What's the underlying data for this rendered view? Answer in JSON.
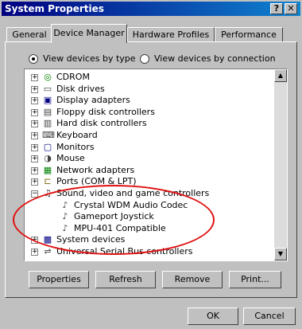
{
  "window": {
    "title": "System Properties",
    "help_label": "?",
    "close_label": "✕"
  },
  "tabs": [
    {
      "label": "General"
    },
    {
      "label": "Device Manager"
    },
    {
      "label": "Hardware Profiles"
    },
    {
      "label": "Performance"
    }
  ],
  "view_options": {
    "by_type": "View devices by type",
    "by_connection": "View devices by connection",
    "selected": "by_type"
  },
  "tree": [
    {
      "label": "CDROM",
      "icon": "cdrom-icon",
      "expander": "+"
    },
    {
      "label": "Disk drives",
      "icon": "disk-icon",
      "expander": "+"
    },
    {
      "label": "Display adapters",
      "icon": "display-icon",
      "expander": "+"
    },
    {
      "label": "Floppy disk controllers",
      "icon": "floppy-icon",
      "expander": "+"
    },
    {
      "label": "Hard disk controllers",
      "icon": "harddisk-icon",
      "expander": "+"
    },
    {
      "label": "Keyboard",
      "icon": "keyboard-icon",
      "expander": "+"
    },
    {
      "label": "Monitors",
      "icon": "monitor-icon",
      "expander": "+"
    },
    {
      "label": "Mouse",
      "icon": "mouse-icon",
      "expander": "+"
    },
    {
      "label": "Network adapters",
      "icon": "network-icon",
      "expander": "+"
    },
    {
      "label": "Ports (COM & LPT)",
      "icon": "port-icon",
      "expander": "+"
    },
    {
      "label": "Sound, video and game controllers",
      "icon": "sound-icon",
      "expander": "−"
    },
    {
      "label": "Crystal WDM Audio Codec",
      "icon": "sound-device-icon",
      "child": true
    },
    {
      "label": "Gameport Joystick",
      "icon": "sound-device-icon",
      "child": true
    },
    {
      "label": "MPU-401 Compatible",
      "icon": "sound-device-icon",
      "child": true
    },
    {
      "label": "System devices",
      "icon": "system-icon",
      "expander": "+"
    },
    {
      "label": "Universal Serial Bus controllers",
      "icon": "usb-icon",
      "expander": "+"
    }
  ],
  "actions": {
    "properties": "Properties",
    "refresh": "Refresh",
    "remove": "Remove",
    "print": "Print..."
  },
  "footer": {
    "ok": "OK",
    "cancel": "Cancel"
  },
  "colors": {
    "title_bar": "#000080",
    "highlight_ellipse": "#e01010"
  }
}
